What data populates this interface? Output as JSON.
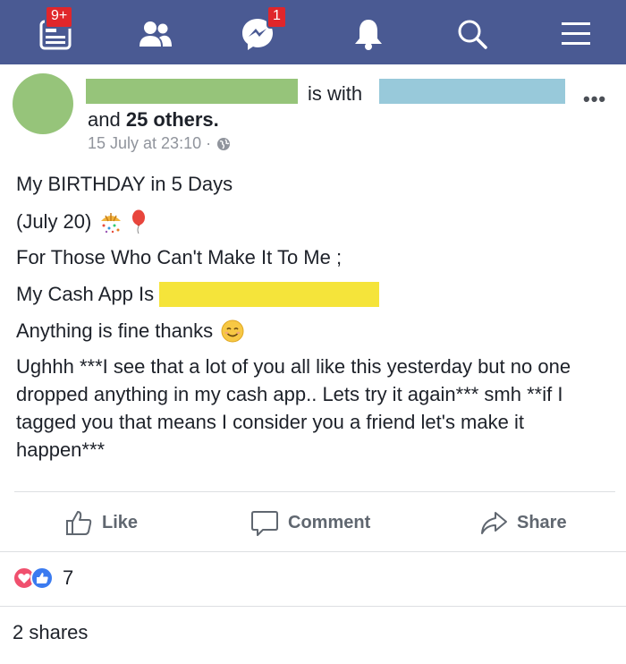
{
  "navbar": {
    "notifications_badge": "9+",
    "messenger_badge": "1",
    "icons": [
      "news-feed-icon",
      "friends-icon",
      "messenger-icon",
      "bell-icon",
      "search-icon",
      "menu-icon"
    ],
    "colors": {
      "bar": "#4a5a93",
      "badge": "#e0262b"
    }
  },
  "post": {
    "is_with": "is with",
    "and_text": "and",
    "others_count": "25 others.",
    "timestamp": "15 July at 23:10 ·",
    "more": "•••",
    "lines": [
      "My BIRTHDAY in 5 Days",
      "(July 20)",
      "For Those Who Can't Make It To Me ;",
      "My Cash App Is",
      "Anything is fine thanks"
    ],
    "paragraph": "Ughhh ***I see that a lot of you all like this yesterday but no one dropped anything in my cash app.. Lets try it again*** smh **if I tagged you that means I consider you a friend let's make it happen***",
    "redaction_colors": {
      "avatar": "#96c47a",
      "name": "#96c47a",
      "tagged": "#98c9da",
      "cashapp": "#f5e43a"
    }
  },
  "actions": {
    "like": "Like",
    "comment": "Comment",
    "share": "Share"
  },
  "footer": {
    "reaction_count": "7",
    "shares": "2 shares"
  }
}
